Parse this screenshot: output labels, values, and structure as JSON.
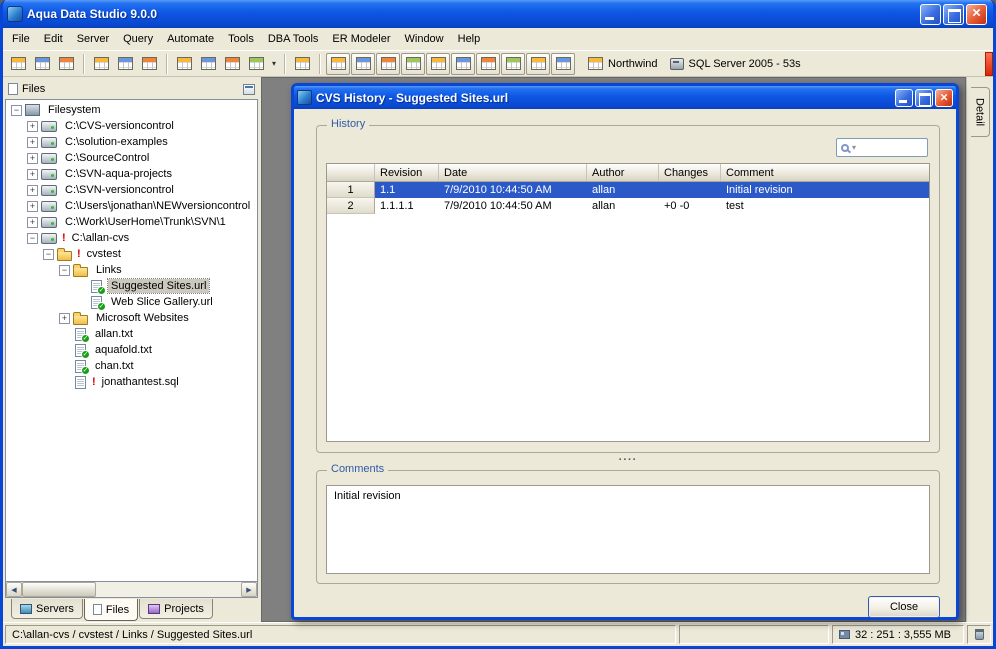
{
  "window": {
    "title": "Aqua Data Studio 9.0.0",
    "controls": [
      "minimize-icon",
      "maximize-icon",
      "close-icon"
    ]
  },
  "menubar": {
    "items": [
      "File",
      "Edit",
      "Server",
      "Query",
      "Automate",
      "Tools",
      "DBA Tools",
      "ER Modeler",
      "Window",
      "Help"
    ]
  },
  "toolbar": {
    "groups": [
      {
        "icons": [
          "register-server-icon",
          "server-registration-icon",
          "window-list-icon"
        ]
      },
      {
        "icons": [
          "folder-key-icon",
          "schema-browser-icon",
          "security-manager-icon"
        ]
      },
      {
        "icons": [
          "query-analyzer-icon",
          "query-builder-icon",
          "table-editor-icon",
          "procedure-editor-icon"
        ],
        "dropdown": true
      },
      {
        "icons": [
          "results-grid-icon"
        ]
      },
      {
        "framed": true,
        "icons": [
          "grid-view-1-icon",
          "grid-view-2-icon",
          "grid-view-3-icon",
          "grid-view-4-icon",
          "grid-view-5-icon",
          "grid-view-6-icon",
          "grid-view-7-icon",
          "grid-view-8-icon",
          "grid-view-9-icon",
          "grid-view-10-icon"
        ]
      }
    ],
    "database_name": "Northwind",
    "server_status": "SQL Server 2005 - 53s"
  },
  "files_panel": {
    "title": "Files",
    "tree": [
      {
        "label": "Filesystem",
        "depth": 0,
        "icon": "filesystem",
        "expander": "minus"
      },
      {
        "label": "C:\\CVS-versioncontrol",
        "depth": 1,
        "icon": "drive",
        "expander": "plus"
      },
      {
        "label": "C:\\solution-examples",
        "depth": 1,
        "icon": "drive",
        "expander": "plus"
      },
      {
        "label": "C:\\SourceControl",
        "depth": 1,
        "icon": "drive",
        "expander": "plus"
      },
      {
        "label": "C:\\SVN-aqua-projects",
        "depth": 1,
        "icon": "drive",
        "expander": "plus"
      },
      {
        "label": "C:\\SVN-versioncontrol",
        "depth": 1,
        "icon": "drive",
        "expander": "plus"
      },
      {
        "label": "C:\\Users\\jonathan\\NEWversioncontrol",
        "depth": 1,
        "icon": "drive",
        "expander": "plus"
      },
      {
        "label": "C:\\Work\\UserHome\\Trunk\\SVN\\1",
        "depth": 1,
        "icon": "drive",
        "expander": "plus"
      },
      {
        "label": "C:\\allan-cvs",
        "depth": 1,
        "icon": "drive",
        "status": "error",
        "expander": "minus"
      },
      {
        "label": "cvstest",
        "depth": 2,
        "icon": "folder",
        "status": "error",
        "expander": "minus"
      },
      {
        "label": "Links",
        "depth": 3,
        "icon": "folder",
        "expander": "minus"
      },
      {
        "label": "Suggested Sites.url",
        "depth": 4,
        "icon": "file",
        "status": "ok",
        "selected": true
      },
      {
        "label": "Web Slice Gallery.url",
        "depth": 4,
        "icon": "file",
        "status": "ok"
      },
      {
        "label": "Microsoft Websites",
        "depth": 3,
        "icon": "folder",
        "expander": "plus"
      },
      {
        "label": "allan.txt",
        "depth": 3,
        "icon": "file",
        "status": "ok"
      },
      {
        "label": "aquafold.txt",
        "depth": 3,
        "icon": "file",
        "status": "ok"
      },
      {
        "label": "chan.txt",
        "depth": 3,
        "icon": "file",
        "status": "ok"
      },
      {
        "label": "jonathantest.sql",
        "depth": 3,
        "icon": "file",
        "status": "error"
      }
    ],
    "tabs": [
      {
        "label": "Servers",
        "icon": "servers-tab-icon"
      },
      {
        "label": "Files",
        "icon": "files-tab-icon",
        "active": true
      },
      {
        "label": "Projects",
        "icon": "projects-tab-icon"
      }
    ]
  },
  "dialog": {
    "title": "CVS History - Suggested Sites.url",
    "history_label": "History",
    "comments_label": "Comments",
    "comments_text": "Initial revision",
    "close_label": "Close",
    "search_value": "",
    "table": {
      "columns": [
        "Revision",
        "Date",
        "Author",
        "Changes",
        "Comment"
      ],
      "rows": [
        {
          "num": "1",
          "cells": [
            "1.1",
            "7/9/2010 10:44:50 AM",
            "allan",
            "",
            "Initial revision"
          ],
          "selected": true
        },
        {
          "num": "2",
          "cells": [
            "1.1.1.1",
            "7/9/2010 10:44:50 AM",
            "allan",
            "+0 -0",
            "test"
          ],
          "selected": false
        }
      ]
    }
  },
  "detail_tab": "Detail",
  "statusbar": {
    "path": "C:\\allan-cvs / cvstest / Links / Suggested Sites.url",
    "memory": "32 : 251 : 3,555 MB"
  },
  "colors": {
    "selection_blue": "#2C59C8",
    "xp_beige": "#ECE9D8",
    "title_blue": "#0C54E0",
    "dialog_border": "#0846D8",
    "label_blue": "#2F5BA8",
    "error_red": "#D80000",
    "ok_green": "#18A018"
  }
}
